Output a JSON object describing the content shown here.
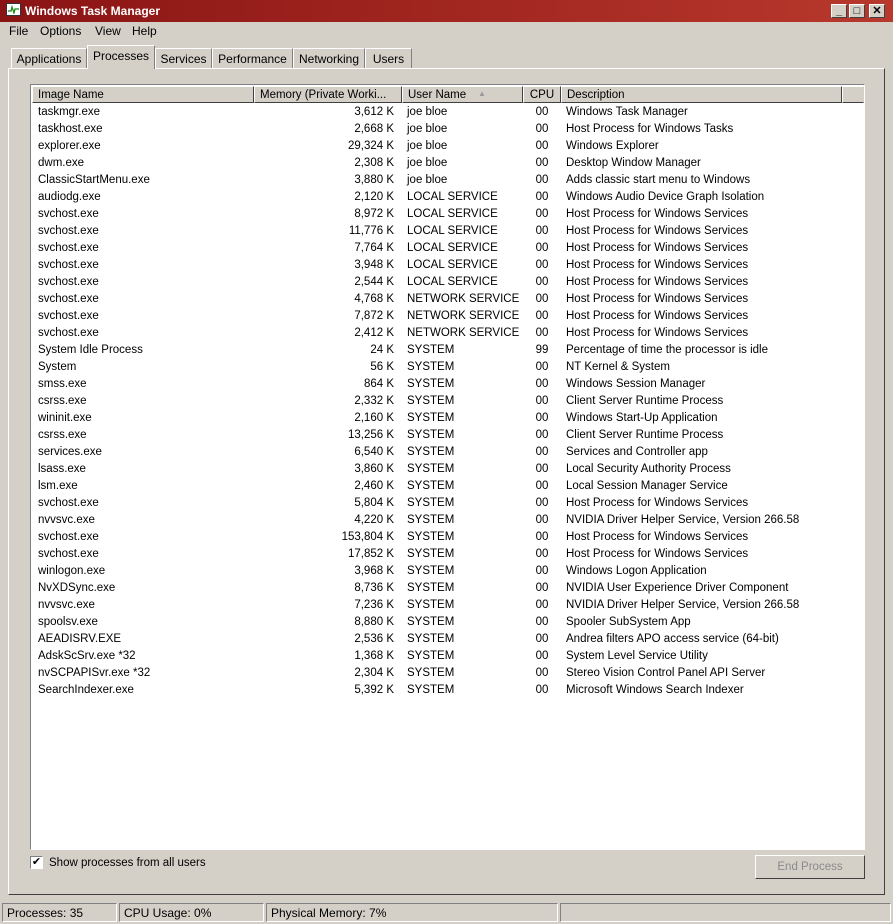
{
  "window": {
    "title": "Windows Task Manager",
    "minimize_label": "_",
    "maximize_label": "□",
    "close_label": "✕"
  },
  "menu": [
    "File",
    "Options",
    "View",
    "Help"
  ],
  "tabs": [
    "Applications",
    "Processes",
    "Services",
    "Performance",
    "Networking",
    "Users"
  ],
  "active_tab": "Processes",
  "table": {
    "columns": [
      "Image Name",
      "Memory (Private Worki...",
      "User Name",
      "CPU",
      "Description"
    ],
    "sorted_column": "User Name",
    "sort_indicator": "▲",
    "rows": [
      [
        "taskmgr.exe",
        "3,612 K",
        "joe bloe",
        "00",
        "Windows Task Manager"
      ],
      [
        "taskhost.exe",
        "2,668 K",
        "joe bloe",
        "00",
        "Host Process for Windows Tasks"
      ],
      [
        "explorer.exe",
        "29,324 K",
        "joe bloe",
        "00",
        "Windows Explorer"
      ],
      [
        "dwm.exe",
        "2,308 K",
        "joe bloe",
        "00",
        "Desktop Window Manager"
      ],
      [
        "ClassicStartMenu.exe",
        "3,880 K",
        "joe bloe",
        "00",
        "Adds classic start menu to Windows"
      ],
      [
        "audiodg.exe",
        "2,120 K",
        "LOCAL SERVICE",
        "00",
        "Windows Audio Device Graph Isolation"
      ],
      [
        "svchost.exe",
        "8,972 K",
        "LOCAL SERVICE",
        "00",
        "Host Process for Windows Services"
      ],
      [
        "svchost.exe",
        "11,776 K",
        "LOCAL SERVICE",
        "00",
        "Host Process for Windows Services"
      ],
      [
        "svchost.exe",
        "7,764 K",
        "LOCAL SERVICE",
        "00",
        "Host Process for Windows Services"
      ],
      [
        "svchost.exe",
        "3,948 K",
        "LOCAL SERVICE",
        "00",
        "Host Process for Windows Services"
      ],
      [
        "svchost.exe",
        "2,544 K",
        "LOCAL SERVICE",
        "00",
        "Host Process for Windows Services"
      ],
      [
        "svchost.exe",
        "4,768 K",
        "NETWORK SERVICE",
        "00",
        "Host Process for Windows Services"
      ],
      [
        "svchost.exe",
        "7,872 K",
        "NETWORK SERVICE",
        "00",
        "Host Process for Windows Services"
      ],
      [
        "svchost.exe",
        "2,412 K",
        "NETWORK SERVICE",
        "00",
        "Host Process for Windows Services"
      ],
      [
        "System Idle Process",
        "24 K",
        "SYSTEM",
        "99",
        "Percentage of time the processor is idle"
      ],
      [
        "System",
        "56 K",
        "SYSTEM",
        "00",
        "NT Kernel & System"
      ],
      [
        "smss.exe",
        "864 K",
        "SYSTEM",
        "00",
        "Windows Session Manager"
      ],
      [
        "csrss.exe",
        "2,332 K",
        "SYSTEM",
        "00",
        "Client Server Runtime Process"
      ],
      [
        "wininit.exe",
        "2,160 K",
        "SYSTEM",
        "00",
        "Windows Start-Up Application"
      ],
      [
        "csrss.exe",
        "13,256 K",
        "SYSTEM",
        "00",
        "Client Server Runtime Process"
      ],
      [
        "services.exe",
        "6,540 K",
        "SYSTEM",
        "00",
        "Services and Controller app"
      ],
      [
        "lsass.exe",
        "3,860 K",
        "SYSTEM",
        "00",
        "Local Security Authority Process"
      ],
      [
        "lsm.exe",
        "2,460 K",
        "SYSTEM",
        "00",
        "Local Session Manager Service"
      ],
      [
        "svchost.exe",
        "5,804 K",
        "SYSTEM",
        "00",
        "Host Process for Windows Services"
      ],
      [
        "nvvsvc.exe",
        "4,220 K",
        "SYSTEM",
        "00",
        "NVIDIA Driver Helper Service, Version 266.58"
      ],
      [
        "svchost.exe",
        "153,804 K",
        "SYSTEM",
        "00",
        "Host Process for Windows Services"
      ],
      [
        "svchost.exe",
        "17,852 K",
        "SYSTEM",
        "00",
        "Host Process for Windows Services"
      ],
      [
        "winlogon.exe",
        "3,968 K",
        "SYSTEM",
        "00",
        "Windows Logon Application"
      ],
      [
        "NvXDSync.exe",
        "8,736 K",
        "SYSTEM",
        "00",
        "NVIDIA User Experience Driver Component"
      ],
      [
        "nvvsvc.exe",
        "7,236 K",
        "SYSTEM",
        "00",
        "NVIDIA Driver Helper Service, Version 266.58"
      ],
      [
        "spoolsv.exe",
        "8,880 K",
        "SYSTEM",
        "00",
        "Spooler SubSystem App"
      ],
      [
        "AEADISRV.EXE",
        "2,536 K",
        "SYSTEM",
        "00",
        "Andrea filters APO access service (64-bit)"
      ],
      [
        "AdskScSrv.exe *32",
        "1,368 K",
        "SYSTEM",
        "00",
        "System Level Service Utility"
      ],
      [
        "nvSCPAPISvr.exe *32",
        "2,304 K",
        "SYSTEM",
        "00",
        "Stereo Vision Control Panel API Server"
      ],
      [
        "SearchIndexer.exe",
        "5,392 K",
        "SYSTEM",
        "00",
        "Microsoft Windows Search Indexer"
      ]
    ]
  },
  "show_all_users": {
    "label": "Show processes from all users",
    "checked": true,
    "check_glyph": "✔"
  },
  "end_process_label": "End Process",
  "status": {
    "processes": "Processes: 35",
    "cpu": "CPU Usage: 0%",
    "memory": "Physical Memory: 7%"
  }
}
